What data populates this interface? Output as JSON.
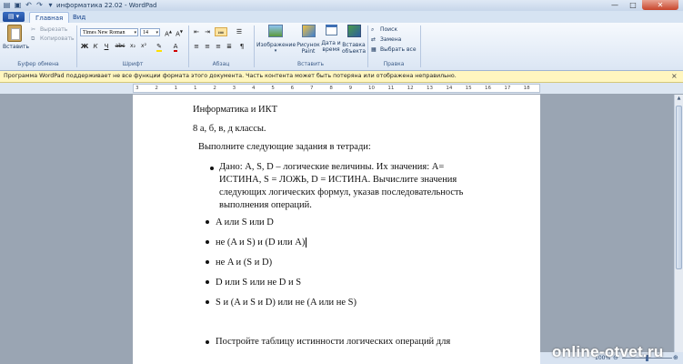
{
  "window": {
    "title": "информатика 22.02 - WordPad",
    "controls": {
      "minimize": "—",
      "maximize": "□",
      "close": "✕"
    }
  },
  "tabs": [
    {
      "label": "Главная"
    },
    {
      "label": "Вид"
    }
  ],
  "ribbon": {
    "clipboard": {
      "group": "Буфер обмена",
      "paste": "Вставить",
      "cut": "Вырезать",
      "copy": "Копировать"
    },
    "font": {
      "group": "Шрифт",
      "family": "Times New Roman",
      "size": "14",
      "bold": "Ж",
      "italic": "К",
      "underline": "Ч",
      "strike": "abc",
      "sub": "x₂",
      "sup": "x²",
      "color_letter": "A"
    },
    "paragraph": {
      "group": "Абзац"
    },
    "insert": {
      "group": "Вставить",
      "image": "Изображение",
      "paint1": "Рисунок",
      "paint2": "Paint",
      "datetime1": "Дата и",
      "datetime2": "время",
      "object1": "Вставка",
      "object2": "объекта"
    },
    "editing": {
      "group": "Правка",
      "find": "Поиск",
      "replace": "Замена",
      "select_all": "Выбрать все"
    }
  },
  "infobar": {
    "text": "Программа WordPad поддерживает не все функции формата этого документа. Часть контента может быть потеряна или отображена неправильно.",
    "close": "×"
  },
  "ruler": {
    "ticks": [
      "3",
      "2",
      "1",
      "1",
      "2",
      "3",
      "4",
      "5",
      "6",
      "7",
      "8",
      "9",
      "10",
      "11",
      "12",
      "13",
      "14",
      "15",
      "16",
      "17",
      "18"
    ]
  },
  "document": {
    "title": "Информатика и ИКТ",
    "classes": "8 а, б, в, д классы.",
    "instruction": "Выполните следующие задания в тетради:",
    "task1": [
      "Дано: A, S, D – логические величины. Их значения: A=",
      "ИСТИНА, S = ЛОЖЬ,  D = ИСТИНА. Вычислите значения",
      "следующих  логических формул, указав последовательность",
      "выполнения операций."
    ],
    "formulas": [
      "A или S или D",
      "не (A и S) и (D или A)",
      "не A и (S и D)",
      "D или S или не D и S",
      "S и (A и S и D) или не (A или не S)"
    ],
    "task2": "Постройте таблицу истинности логических операций для"
  },
  "status": {
    "zoom": "100%",
    "zoom_out": "⊖",
    "zoom_in": "⊕"
  },
  "watermark": "online-otvet.ru"
}
